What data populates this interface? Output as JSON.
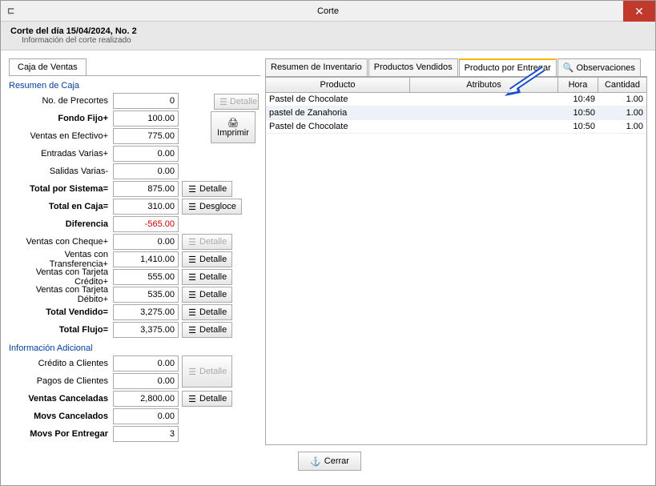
{
  "window": {
    "title": "Corte"
  },
  "header": {
    "title": "Corte del día 15/04/2024, No. 2",
    "subtitle": "Información del corte realizado"
  },
  "left_tab": "Caja de Ventas",
  "resumen_title": "Resumen de Caja",
  "info_adic_title": "Información Adicional",
  "fields": {
    "precortes_lbl": "No. de Precortes",
    "precortes_val": "0",
    "fondo_lbl": "Fondo Fijo+",
    "fondo_val": "100.00",
    "ventas_ef_lbl": "Ventas en Efectivo+",
    "ventas_ef_val": "775.00",
    "ent_var_lbl": "Entradas Varias+",
    "ent_var_val": "0.00",
    "sal_var_lbl": "Salidas Varias-",
    "sal_var_val": "0.00",
    "total_sis_lbl": "Total por Sistema=",
    "total_sis_val": "875.00",
    "total_caja_lbl": "Total en Caja=",
    "total_caja_val": "310.00",
    "dif_lbl": "Diferencia",
    "dif_val": "-565.00",
    "cheque_lbl": "Ventas con Cheque+",
    "cheque_val": "0.00",
    "transf_lbl": "Ventas con Transferencia+",
    "transf_val": "1,410.00",
    "tc_lbl": "Ventas con Tarjeta Crédito+",
    "tc_val": "555.00",
    "td_lbl": "Ventas con Tarjeta Débito+",
    "td_val": "535.00",
    "total_vend_lbl": "Total Vendido=",
    "total_vend_val": "3,275.00",
    "total_flujo_lbl": "Total Flujo=",
    "total_flujo_val": "3,375.00",
    "cred_cli_lbl": "Crédito a Clientes",
    "cred_cli_val": "0.00",
    "pagos_cli_lbl": "Pagos de Clientes",
    "pagos_cli_val": "0.00",
    "vent_canc_lbl": "Ventas Canceladas",
    "vent_canc_val": "2,800.00",
    "movs_canc_lbl": "Movs Cancelados",
    "movs_canc_val": "0.00",
    "movs_ent_lbl": "Movs Por Entregar",
    "movs_ent_val": "3"
  },
  "buttons": {
    "detalle": "Detalle",
    "desgloce": "Desgloce",
    "imprimir": "Imprimir",
    "cerrar": "Cerrar"
  },
  "rtabs": {
    "t1": "Resumen de Inventario",
    "t2": "Productos Vendidos",
    "t3": "Producto por Entregar",
    "t4": "Observaciones"
  },
  "grid": {
    "h1": "Producto",
    "h2": "Atributos",
    "h3": "Hora",
    "h4": "Cantidad",
    "rows": [
      {
        "p": "Pastel de Chocolate",
        "a": "",
        "h": "10:49",
        "c": "1.00"
      },
      {
        "p": "pastel de Zanahoria",
        "a": "",
        "h": "10:50",
        "c": "1.00"
      },
      {
        "p": "Pastel de Chocolate",
        "a": "",
        "h": "10:50",
        "c": "1.00"
      }
    ]
  }
}
